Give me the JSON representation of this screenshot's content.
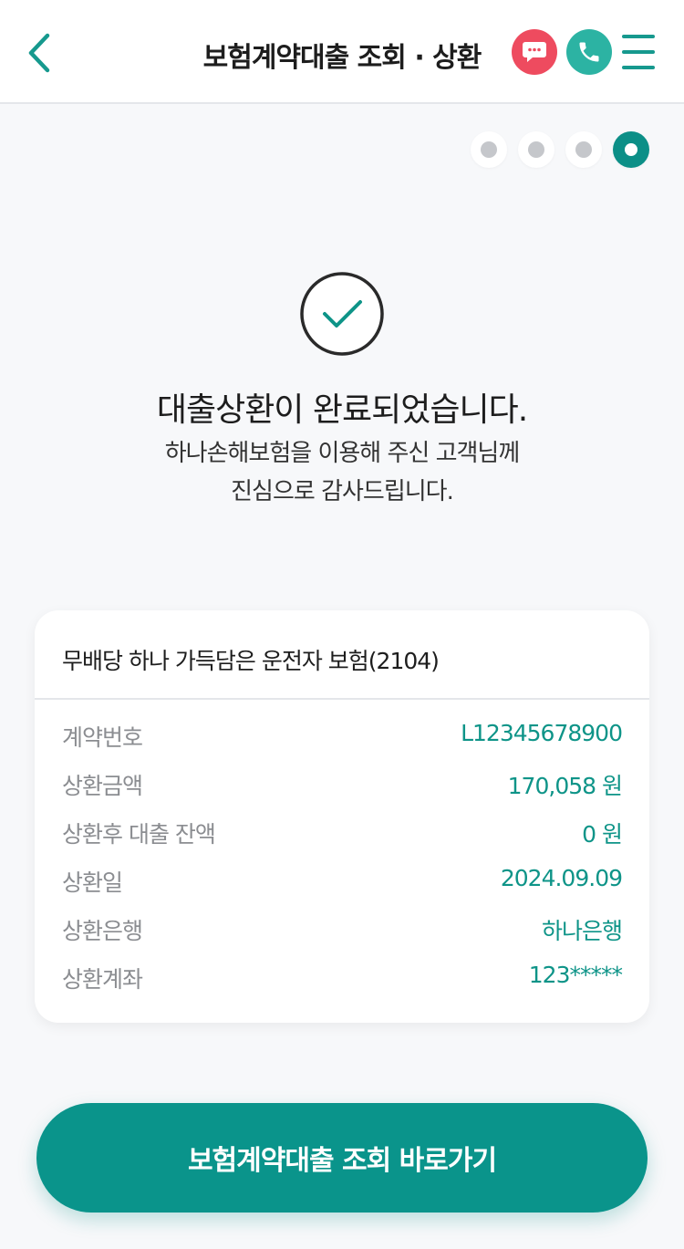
{
  "header": {
    "title": "보험계약대출 조회 · 상환",
    "back_icon": "chevron-left-icon",
    "chat_icon": "chat-bubble-icon",
    "call_icon": "phone-icon",
    "menu_icon": "hamburger-menu-icon"
  },
  "steps": {
    "total": 4,
    "current": 4
  },
  "result": {
    "icon": "check-circle-icon",
    "title": "대출상환이 완료되었습니다.",
    "line1": "하나손해보험을 이용해 주신 고객님께",
    "line2": "진심으로 감사드립니다."
  },
  "card": {
    "product_name": "무배당 하나 가득담은 운전자 보험(2104)",
    "rows": [
      {
        "label": "계약번호",
        "value": "L12345678900"
      },
      {
        "label": "상환금액",
        "value": "170,058 원"
      },
      {
        "label": "상환후 대출 잔액",
        "value": "0 원"
      },
      {
        "label": "상환일",
        "value": "2024.09.09"
      },
      {
        "label": "상환은행",
        "value": "하나은행"
      },
      {
        "label": "상환계좌",
        "value": "123*****"
      }
    ]
  },
  "cta": {
    "label": "보험계약대출 조회 바로가기"
  },
  "colors": {
    "accent": "#0a948b",
    "value_text": "#0e9488",
    "chat_button": "#ee4b5f",
    "call_button": "#2cb3a3",
    "background": "#f7f8fa"
  }
}
